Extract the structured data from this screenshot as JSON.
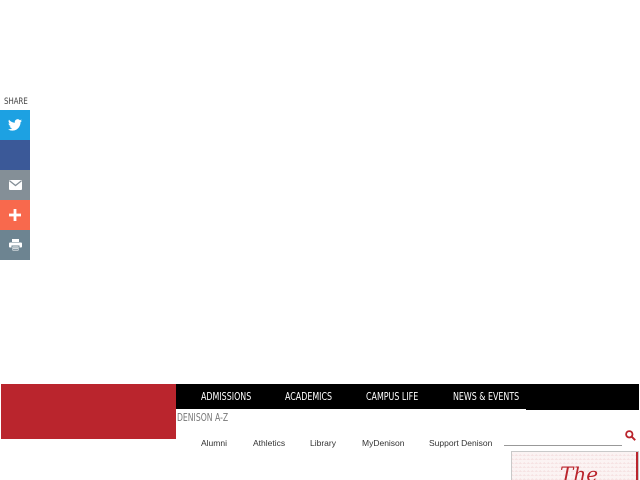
{
  "share": {
    "label": "SHARE",
    "buttons": [
      {
        "name": "twitter",
        "icon": "twitter-icon",
        "color": "#1da1e2"
      },
      {
        "name": "facebook",
        "icon": "facebook-icon",
        "color": "#3b5998"
      },
      {
        "name": "email",
        "icon": "envelope-icon",
        "color": "#848f97"
      },
      {
        "name": "more",
        "icon": "plus-icon",
        "color": "#f8694d"
      },
      {
        "name": "print",
        "icon": "printer-icon",
        "color": "#6d8491"
      }
    ]
  },
  "header": {
    "brand_color": "#ba252d",
    "nav": {
      "items": [
        "Admissions",
        "Academics",
        "Campus Life",
        "News & Events"
      ]
    },
    "az_link": "Denison A-Z",
    "utility_links": [
      "Alumni",
      "Athletics",
      "Library",
      "MyDenison",
      "Support Denison"
    ],
    "search": {
      "placeholder": "",
      "value": ""
    },
    "promo_text": "The"
  }
}
